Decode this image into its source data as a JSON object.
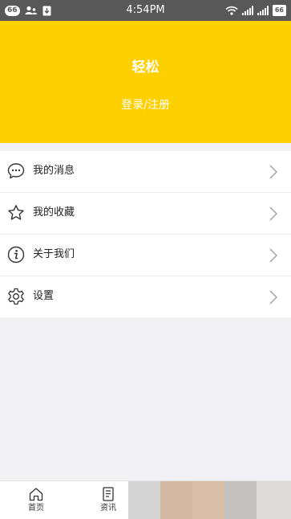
{
  "status_bar": {
    "left_badge": "66",
    "time": "4:54PM",
    "battery": "66"
  },
  "header": {
    "username": "轻松",
    "login_link": "登录/注册",
    "background_color": "#ffd000"
  },
  "menu": {
    "items": [
      {
        "label": "我的消息",
        "icon": "message-icon"
      },
      {
        "label": "我的收藏",
        "icon": "star-icon"
      },
      {
        "label": "关于我们",
        "icon": "info-icon"
      },
      {
        "label": "设置",
        "icon": "gear-icon"
      }
    ]
  },
  "tabbar": {
    "tabs": [
      {
        "label": "首页",
        "icon": "home-icon"
      },
      {
        "label": "资讯",
        "icon": "news-icon"
      }
    ]
  }
}
